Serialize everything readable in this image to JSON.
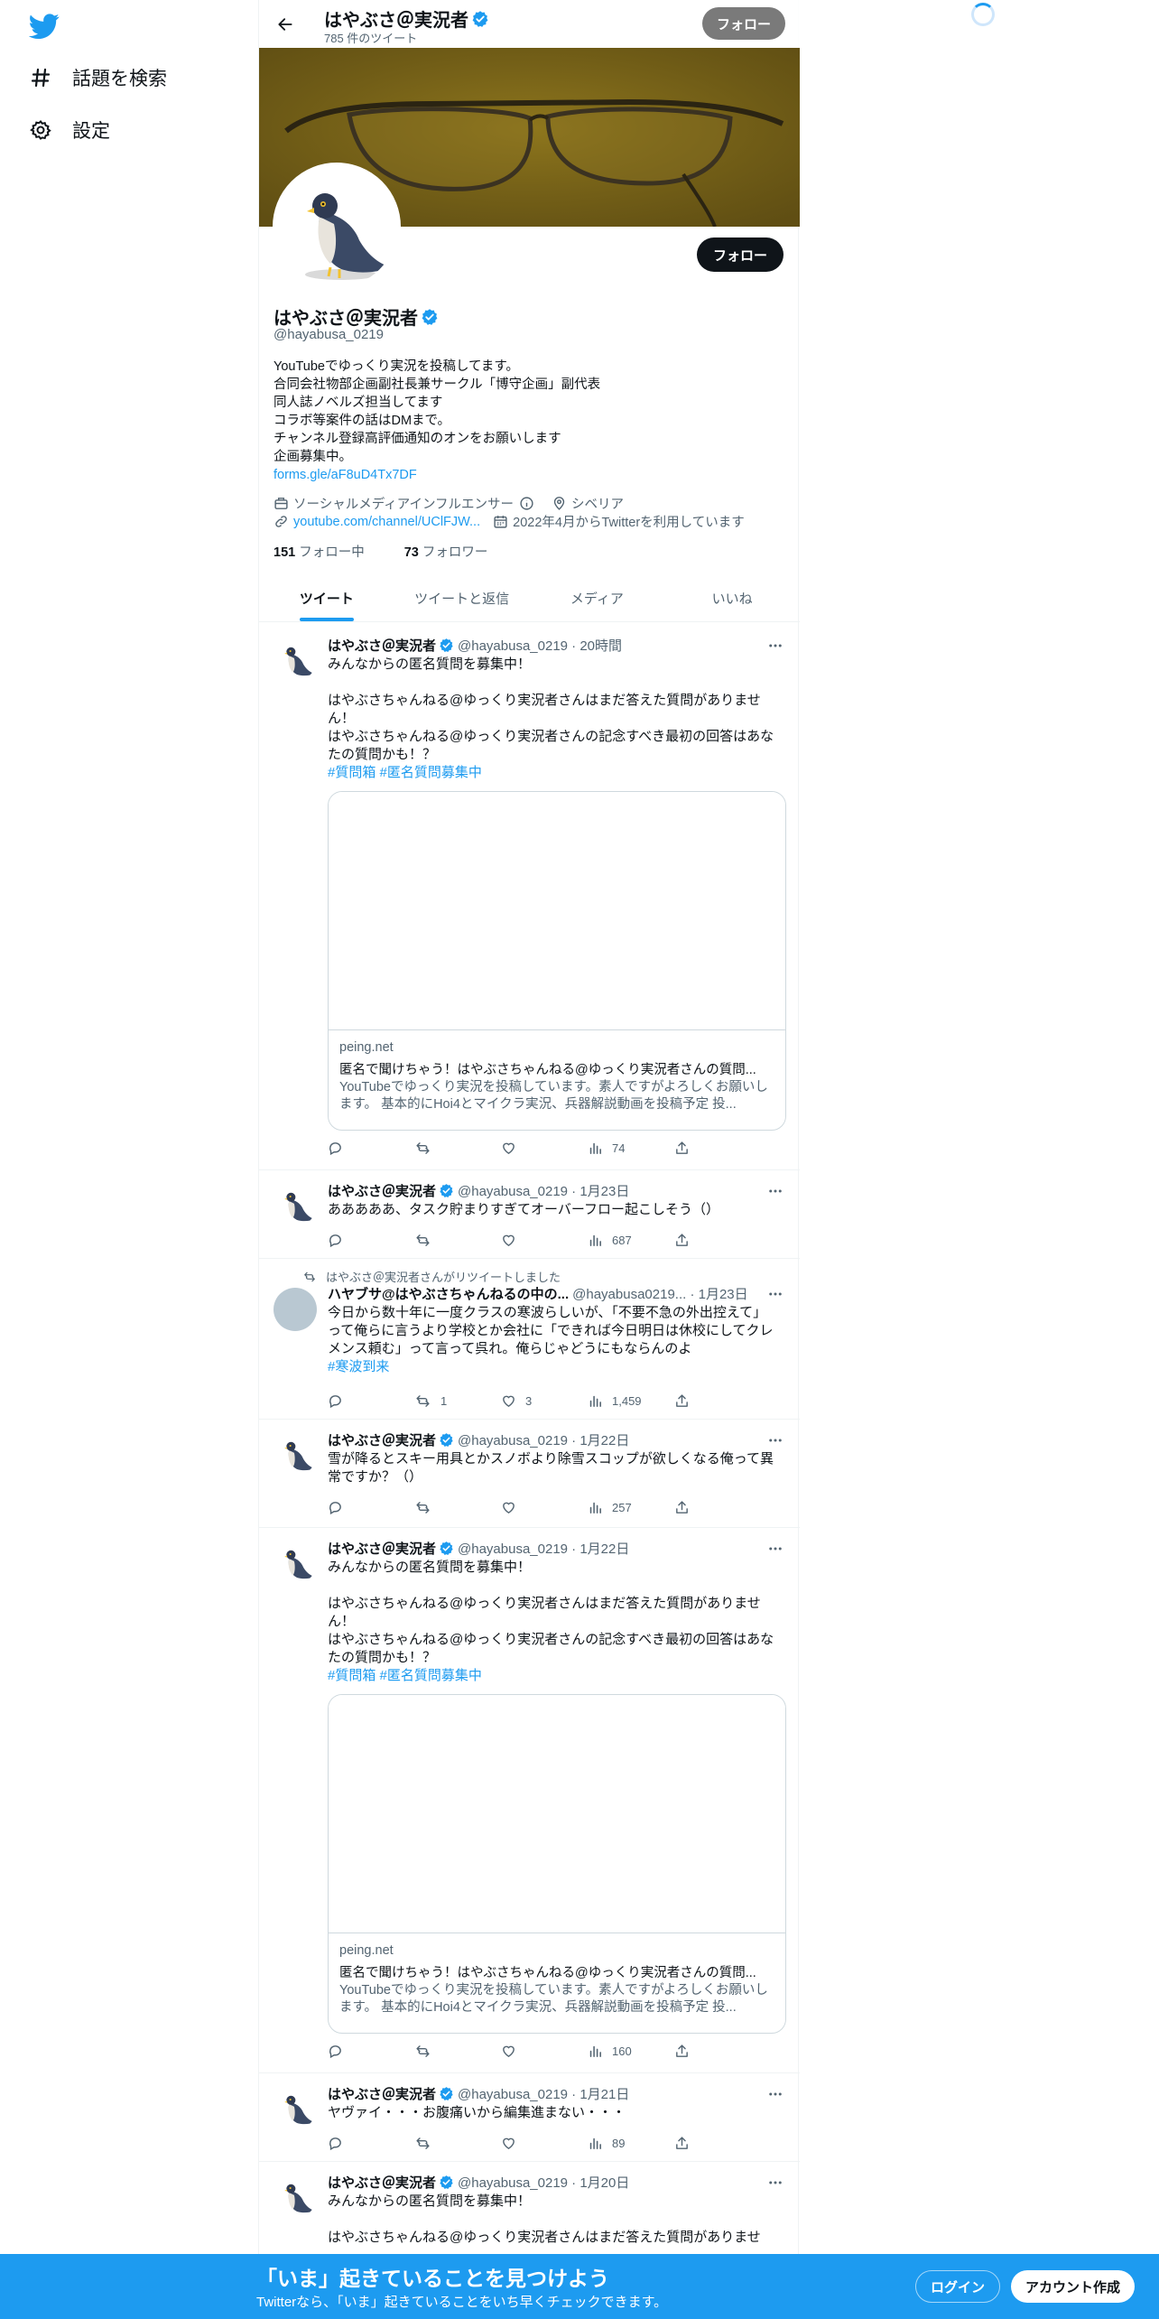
{
  "nav": {
    "explore_label": "話題を検索",
    "settings_label": "設定"
  },
  "topbar": {
    "name": "はやぶさ＠実況者",
    "tweet_count": "785 件のツイート",
    "follow_label": "フォロー"
  },
  "profile": {
    "follow_label": "フォロー",
    "name": "はやぶさ＠実況者",
    "handle": "@hayabusa_0219",
    "bio": [
      "YouTubeでゆっくり実況を投稿してます。",
      "合同会社物部企画副社長兼サークル「博守企画」副代表",
      "同人誌ノベルズ担当してます",
      "コラボ等案件の話はDMまで。",
      "チャンネル登録高評価通知のオンをお願いします",
      "企画募集中。"
    ],
    "bio_link": "forms.gle/aF8uD4Tx7DF",
    "category": "ソーシャルメディアインフルエンサー",
    "location": "シベリア",
    "website": "youtube.com/channel/UClFJW...",
    "joined": "2022年4月からTwitterを利用しています",
    "following_count": "151",
    "following_label": "フォロー中",
    "followers_count": "73",
    "followers_label": "フォロワー"
  },
  "tabs": [
    "ツイート",
    "ツイートと返信",
    "メディア",
    "いいね"
  ],
  "tweets": [
    {
      "name": "はやぶさ＠実況者",
      "meta": "@hayabusa_0219 · 20時間",
      "lines": [
        "みんなからの匿名質問を募集中！",
        "",
        "はやぶさちゃんねる@ゆっくり実況者さんはまだ答えた質問がありませ",
        "ん！",
        "はやぶさちゃんねる@ゆっくり実況者さんの記念すべき最初の回答はあな",
        "たの質問かも！？"
      ],
      "tags": "#質問箱 #匿名質問募集中",
      "card": {
        "domain": "peing.net",
        "title": "匿名で聞けちゃう！はやぶさちゃんねる@ゆっくり実況者さんの質問...",
        "desc": "YouTubeでゆっくり実況を投稿しています。素人ですがよろしくお願いします。 基本的にHoi4とマイクラ実況、兵器解説動画を投稿予定 投..."
      },
      "views": "74"
    },
    {
      "name": "はやぶさ＠実況者",
      "meta": "@hayabusa_0219 · 1月23日",
      "lines": [
        "あああああ、タスク貯まりすぎてオーバーフロー起こしそう（）"
      ],
      "views": "687"
    },
    {
      "retweet_label": "はやぶさ＠実況者さんがリツイートしました",
      "name": "ハヤブサ@はやぶさちゃんねるの中の...",
      "meta": "@hayabusa0219... · 1月23日",
      "lines": [
        "今日から数十年に一度クラスの寒波らしいが、「不要不急の外出控えて」",
        "って俺らに言うより学校とか会社に「できれば今日明日は休校にしてクレ",
        "メンス頼む」って言って呉れ。俺らじゃどうにもならんのよ"
      ],
      "tags": "#寒波到来",
      "retweets": "1",
      "likes": "3",
      "views": "1,459"
    },
    {
      "name": "はやぶさ＠実況者",
      "meta": "@hayabusa_0219 · 1月22日",
      "lines": [
        "雪が降るとスキー用具とかスノボより除雪スコップが欲しくなる俺って異",
        "常ですか？（）"
      ],
      "views": "257"
    },
    {
      "name": "はやぶさ＠実況者",
      "meta": "@hayabusa_0219 · 1月22日",
      "lines": [
        "みんなからの匿名質問を募集中！",
        "",
        "はやぶさちゃんねる@ゆっくり実況者さんはまだ答えた質問がありませ",
        "ん！",
        "はやぶさちゃんねる@ゆっくり実況者さんの記念すべき最初の回答はあな",
        "たの質問かも！？"
      ],
      "tags": "#質問箱 #匿名質問募集中",
      "card": {
        "domain": "peing.net",
        "title": "匿名で聞けちゃう！はやぶさちゃんねる@ゆっくり実況者さんの質問...",
        "desc": "YouTubeでゆっくり実況を投稿しています。素人ですがよろしくお願いします。 基本的にHoi4とマイクラ実況、兵器解説動画を投稿予定 投..."
      },
      "views": "160"
    },
    {
      "name": "はやぶさ＠実況者",
      "meta": "@hayabusa_0219 · 1月21日",
      "lines": [
        "ヤヴァイ・・・お腹痛いから編集進まない・・・"
      ],
      "views": "89"
    },
    {
      "name": "はやぶさ＠実況者",
      "meta": "@hayabusa_0219 · 1月20日",
      "lines": [
        "みんなからの匿名質問を募集中！",
        "",
        "はやぶさちゃんねる@ゆっくり実況者さんはまだ答えた質問がありませ"
      ]
    }
  ],
  "bottombar": {
    "title": "「いま」起きていることを見つけよう",
    "subtitle": "Twitterなら、「いま」起きていることをいち早くチェックできます。",
    "login_label": "ログイン",
    "signup_label": "アカウント作成"
  },
  "colors": {
    "accent": "#1d9bf0",
    "text": "#0f1419",
    "secondary": "#536471"
  }
}
